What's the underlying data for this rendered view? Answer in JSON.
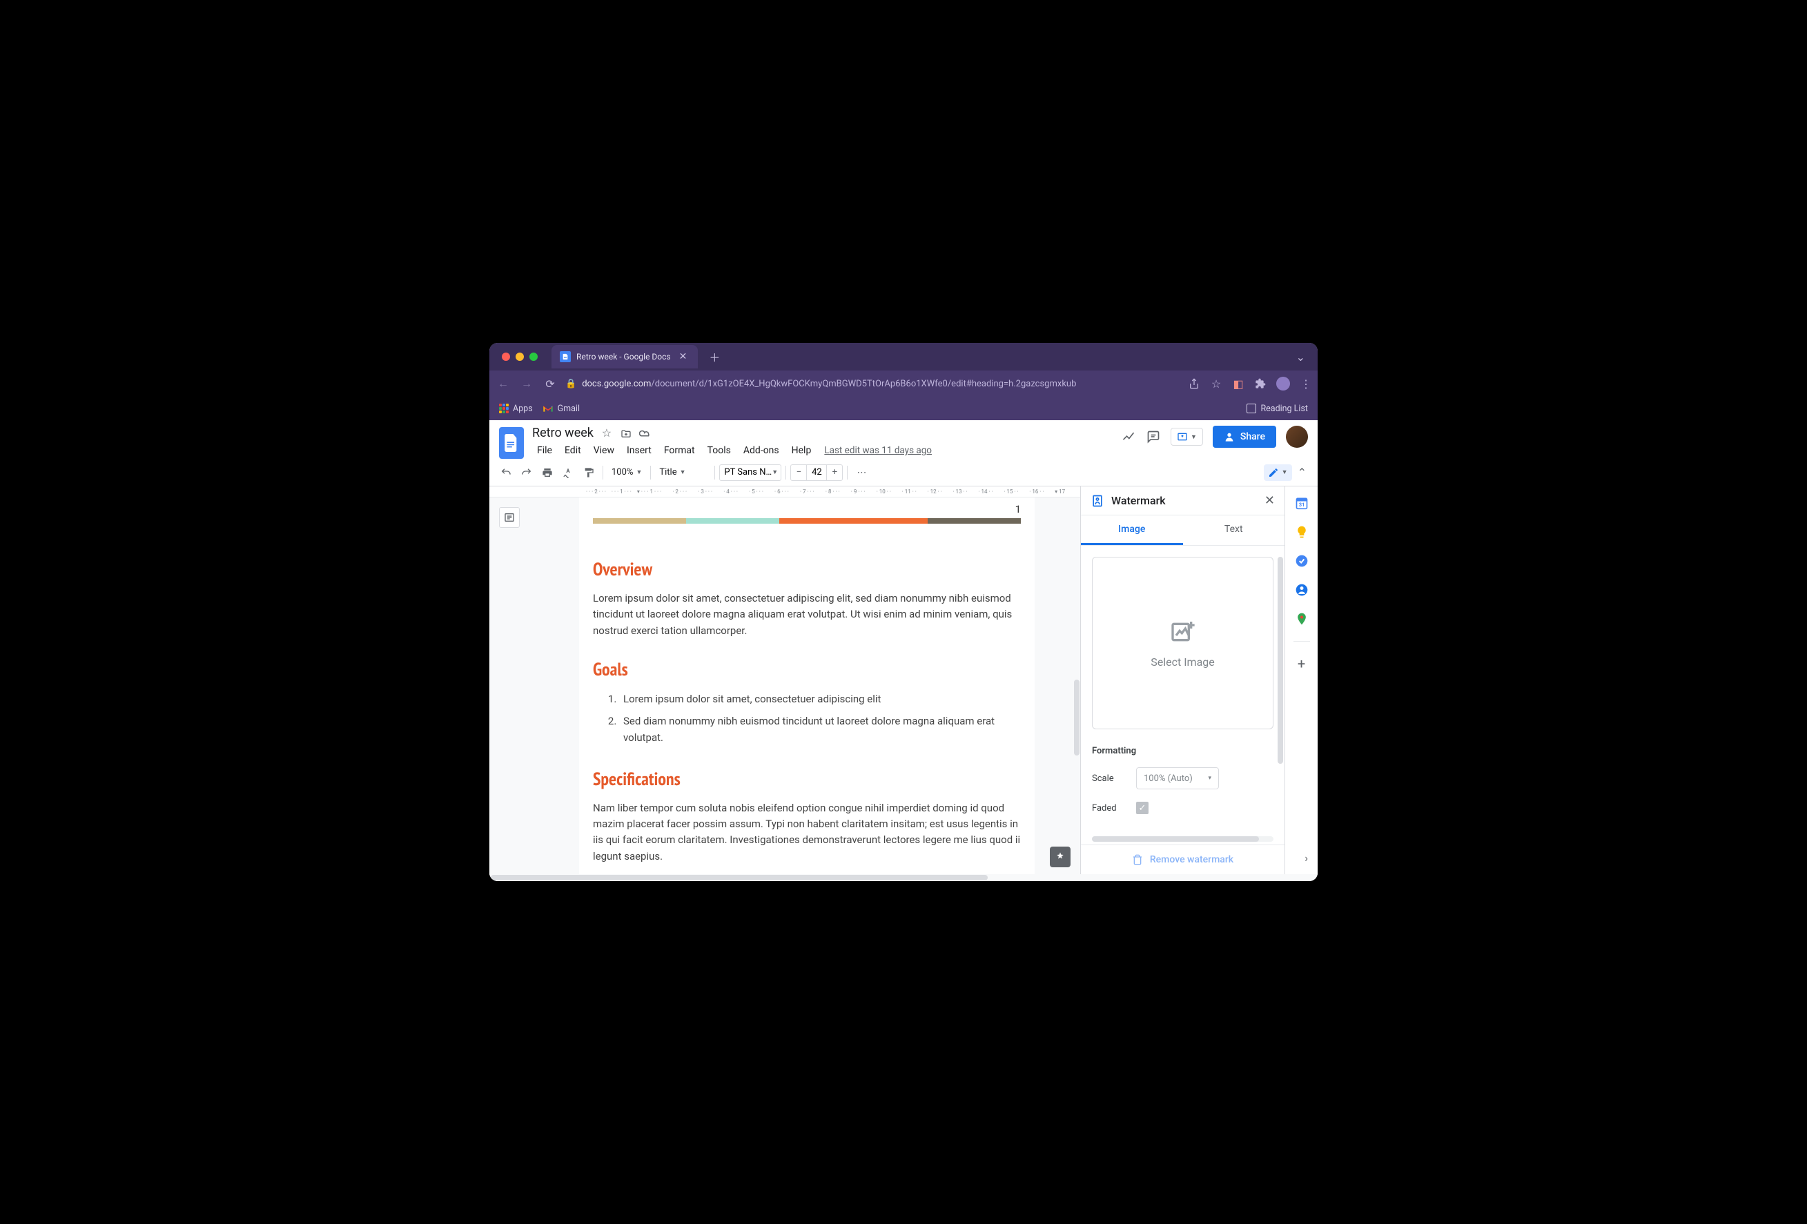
{
  "browser": {
    "tab_title": "Retro week - Google Docs",
    "url_host": "docs.google.com",
    "url_path": "/document/d/1xG1zOE4X_HgQkwFOCKmyQmBGWD5TtOrAp6B6o1XWfe0/edit#heading=h.2gazcsgmxkub",
    "bookmarks": {
      "apps": "Apps",
      "gmail": "Gmail",
      "reading_list": "Reading List"
    }
  },
  "docs": {
    "title": "Retro week",
    "menus": [
      "File",
      "Edit",
      "View",
      "Insert",
      "Format",
      "Tools",
      "Add-ons",
      "Help"
    ],
    "last_edit": "Last edit was 11 days ago",
    "share_label": "Share"
  },
  "toolbar": {
    "zoom": "100%",
    "style": "Title",
    "font": "PT Sans N…",
    "font_size": "42"
  },
  "document": {
    "page_number": "1",
    "stripe_colors": [
      "#d3bd8a",
      "#a3e0d1",
      "#ef6c33",
      "#6e6759"
    ],
    "sections": [
      {
        "heading": "Overview",
        "body": "Lorem ipsum dolor sit amet, consectetuer adipiscing elit, sed diam nonummy nibh euismod tincidunt ut laoreet dolore magna aliquam erat volutpat. Ut wisi enim ad minim veniam, quis nostrud exerci tation ullamcorper."
      },
      {
        "heading": "Goals",
        "list": [
          "Lorem ipsum dolor sit amet, consectetuer adipiscing elit",
          "Sed diam nonummy nibh euismod tincidunt ut laoreet dolore magna aliquam erat volutpat."
        ]
      },
      {
        "heading": "Specifications",
        "body": "Nam liber tempor cum soluta nobis eleifend option congue nihil imperdiet doming id quod mazim placerat facer possim assum. Typi non habent claritatem insitam; est usus legentis in iis qui facit eorum claritatem. Investigationes demonstraverunt lectores legere me lius quod ii legunt saepius."
      }
    ]
  },
  "watermark_panel": {
    "title": "Watermark",
    "tabs": {
      "image": "Image",
      "text": "Text"
    },
    "select_image": "Select Image",
    "formatting_label": "Formatting",
    "scale_label": "Scale",
    "scale_value": "100% (Auto)",
    "faded_label": "Faded",
    "remove_label": "Remove watermark"
  },
  "ruler_marks": [
    "2",
    "1",
    "",
    "1",
    "2",
    "3",
    "4",
    "5",
    "6",
    "7",
    "8",
    "9",
    "10",
    "11",
    "12",
    "13",
    "14",
    "15",
    "16",
    "17"
  ]
}
